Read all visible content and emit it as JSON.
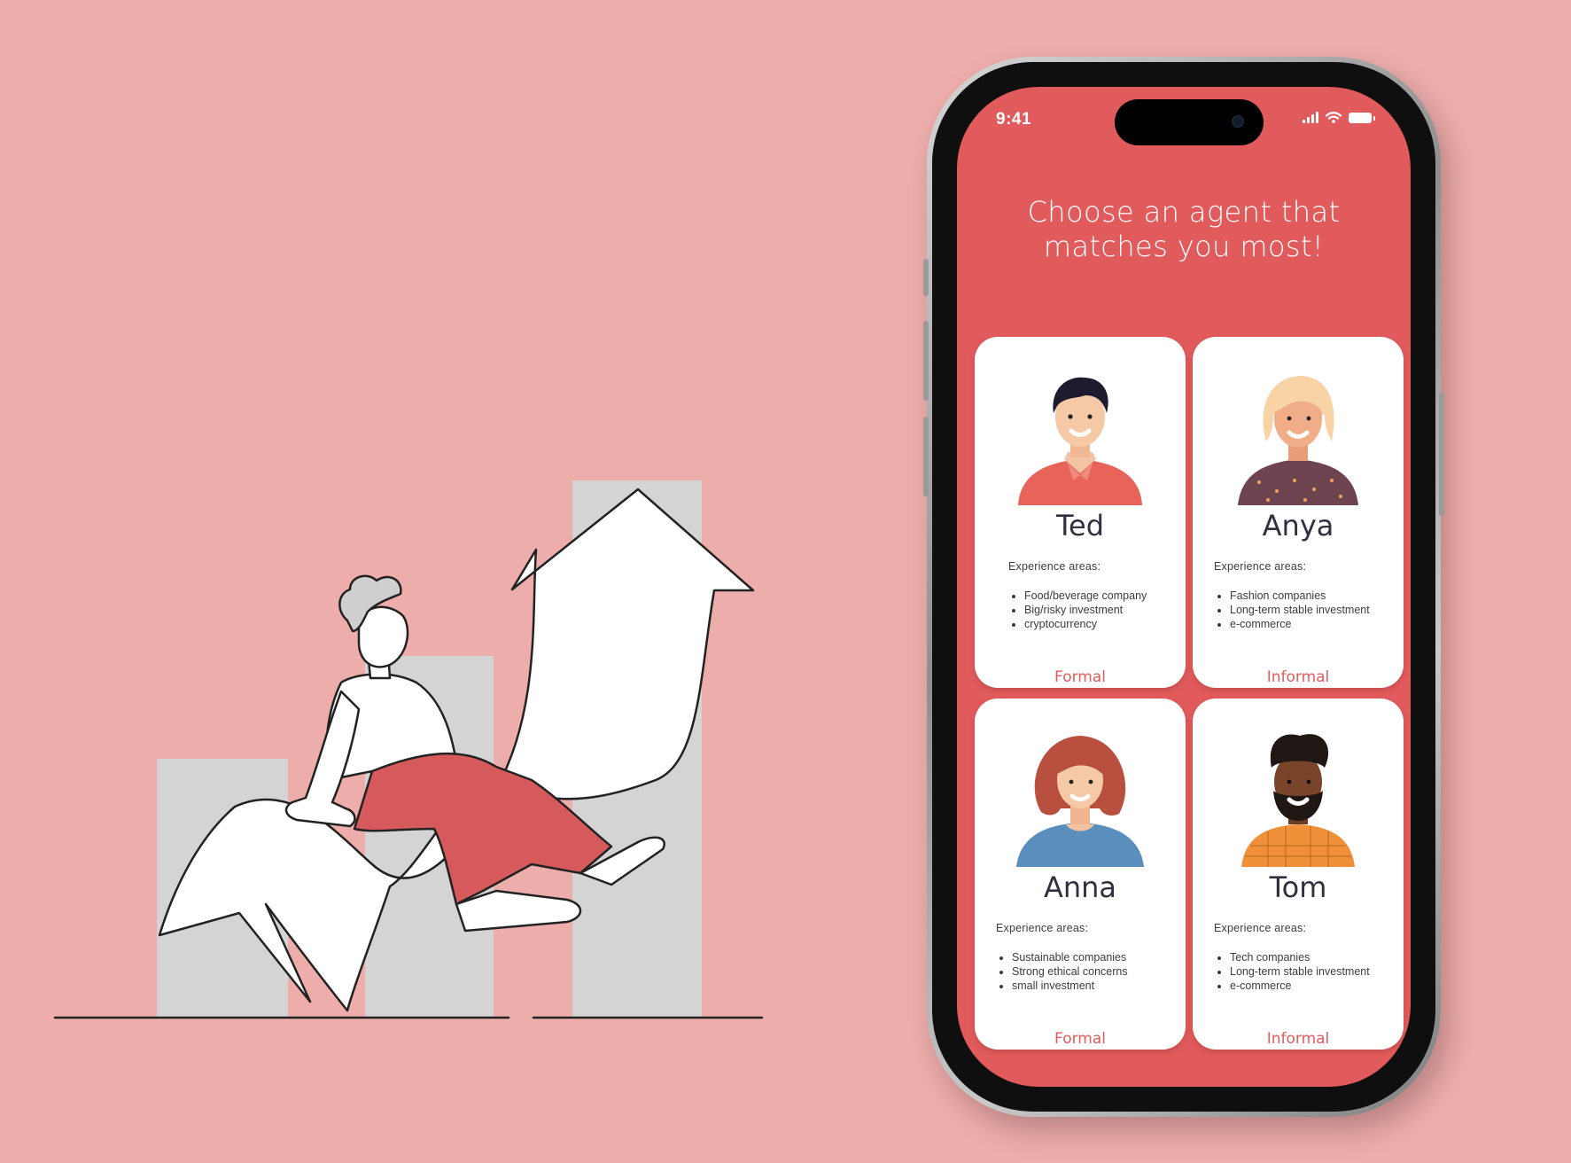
{
  "status_bar": {
    "time": "9:41",
    "icons": [
      "signal-icon",
      "wifi-icon",
      "battery-icon"
    ]
  },
  "screen": {
    "title_line1": "Choose an agent that",
    "title_line2": "matches you most!"
  },
  "agents": [
    {
      "name": "Ted",
      "experience_label": "Experience areas:",
      "areas": [
        "Food/beverage company",
        "Big/risky investment",
        "cryptocurrency"
      ],
      "style": "Formal",
      "avatar": "man-avatar-icon"
    },
    {
      "name": "Anya",
      "experience_label": "Experience areas:",
      "areas": [
        "Fashion companies",
        "Long-term stable investment",
        "e-commerce"
      ],
      "style": "Informal",
      "avatar": "woman-avatar-icon"
    },
    {
      "name": "Anna",
      "experience_label": "Experience areas:",
      "areas": [
        "Sustainable companies",
        "Strong ethical concerns",
        "small investment"
      ],
      "style": "Formal",
      "avatar": "woman-avatar-icon"
    },
    {
      "name": "Tom",
      "experience_label": "Experience areas:",
      "areas": [
        "Tech companies",
        "Long-term stable investment",
        "e-commerce"
      ],
      "style": "Informal",
      "avatar": "man-avatar-icon"
    }
  ],
  "colors": {
    "background": "#ecadab",
    "screen": "#e15b5c",
    "accent": "#e15b5c",
    "card": "#ffffff",
    "text_dark": "#2f3040"
  }
}
